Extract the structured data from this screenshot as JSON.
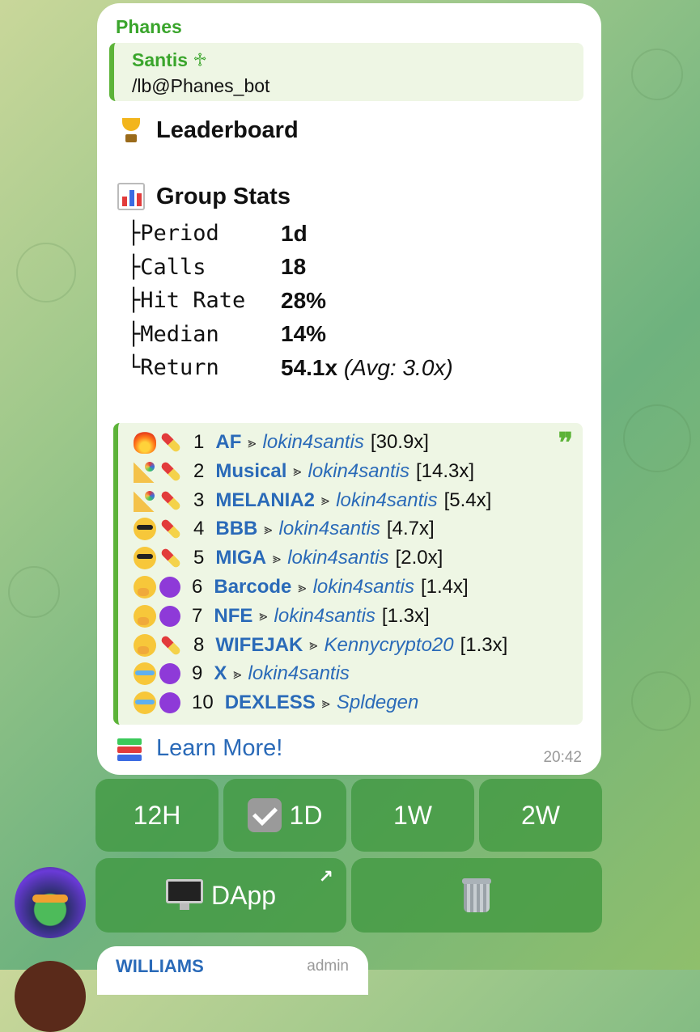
{
  "message": {
    "sender": "Phanes",
    "reply": {
      "name": "Santis ♱",
      "text": "/lb@Phanes_bot"
    },
    "title": "Leaderboard",
    "title_icon": "trophy-icon",
    "stats_title": "Group Stats",
    "stats_icon": "bar-chart-icon",
    "stats": [
      {
        "prefix": "├",
        "key": "Period",
        "value": "1d",
        "extra": ""
      },
      {
        "prefix": "├",
        "key": "Calls",
        "value": "18",
        "extra": ""
      },
      {
        "prefix": "├",
        "key": "Hit Rate",
        "value": "28%",
        "extra": ""
      },
      {
        "prefix": "├",
        "key": "Median",
        "value": "14%",
        "extra": ""
      },
      {
        "prefix": "└",
        "key": "Return",
        "value": "54.1x",
        "extra": "(Avg: 3.0x)"
      }
    ],
    "leaderboard": [
      {
        "rank": "1",
        "ticker": "AF",
        "arrow": "⪢",
        "user": "lokin4santis",
        "mult": "[30.9x]",
        "icon1": "fire",
        "icon2": "pill"
      },
      {
        "rank": "2",
        "ticker": "Musical",
        "arrow": "⪢",
        "user": "lokin4santis",
        "mult": "[14.3x]",
        "icon1": "party",
        "icon2": "pill"
      },
      {
        "rank": "3",
        "ticker": "MELANIA2",
        "arrow": "⪢",
        "user": "lokin4santis",
        "mult": "[5.4x]",
        "icon1": "party",
        "icon2": "pill"
      },
      {
        "rank": "4",
        "ticker": "BBB",
        "arrow": "⪢",
        "user": "lokin4santis",
        "mult": "[4.7x]",
        "icon1": "cool",
        "icon2": "pill"
      },
      {
        "rank": "5",
        "ticker": "MIGA",
        "arrow": "⪢",
        "user": "lokin4santis",
        "mult": "[2.0x]",
        "icon1": "cool",
        "icon2": "pill"
      },
      {
        "rank": "6",
        "ticker": "Barcode",
        "arrow": "⪢",
        "user": "lokin4santis",
        "mult": "[1.4x]",
        "icon1": "yawn",
        "icon2": "dot"
      },
      {
        "rank": "7",
        "ticker": "NFE",
        "arrow": "⪢",
        "user": "lokin4santis",
        "mult": "[1.3x]",
        "icon1": "yawn",
        "icon2": "dot"
      },
      {
        "rank": "8",
        "ticker": "WIFEJAK",
        "arrow": "⪢",
        "user": "Kennycrypto20",
        "mult": "[1.3x]",
        "icon1": "yawn",
        "icon2": "pill"
      },
      {
        "rank": "9",
        "ticker": "X",
        "arrow": "⪢",
        "user": "lokin4santis",
        "mult": "",
        "icon1": "cry",
        "icon2": "dot"
      },
      {
        "rank": "10",
        "ticker": "DEXLESS",
        "arrow": "⪢",
        "user": "Spldegen",
        "mult": "",
        "icon1": "cry",
        "icon2": "dot"
      }
    ],
    "quote_mark": "❞",
    "learn_more": "Learn More!",
    "time": "20:42"
  },
  "keyboard": {
    "row1": [
      {
        "label": "12H",
        "selected": false
      },
      {
        "label": "1D",
        "selected": true
      },
      {
        "label": "1W",
        "selected": false
      },
      {
        "label": "2W",
        "selected": false
      }
    ],
    "dapp_label": "DApp",
    "dapp_arrow": "↗",
    "delete_icon": "trash-icon"
  },
  "next_message": {
    "name": "WILLIAMS",
    "role": "admin"
  },
  "colors": {
    "accent_green": "#3aa52c",
    "link_blue": "#2a6ab8",
    "quote_bg": "#eef6e4"
  }
}
